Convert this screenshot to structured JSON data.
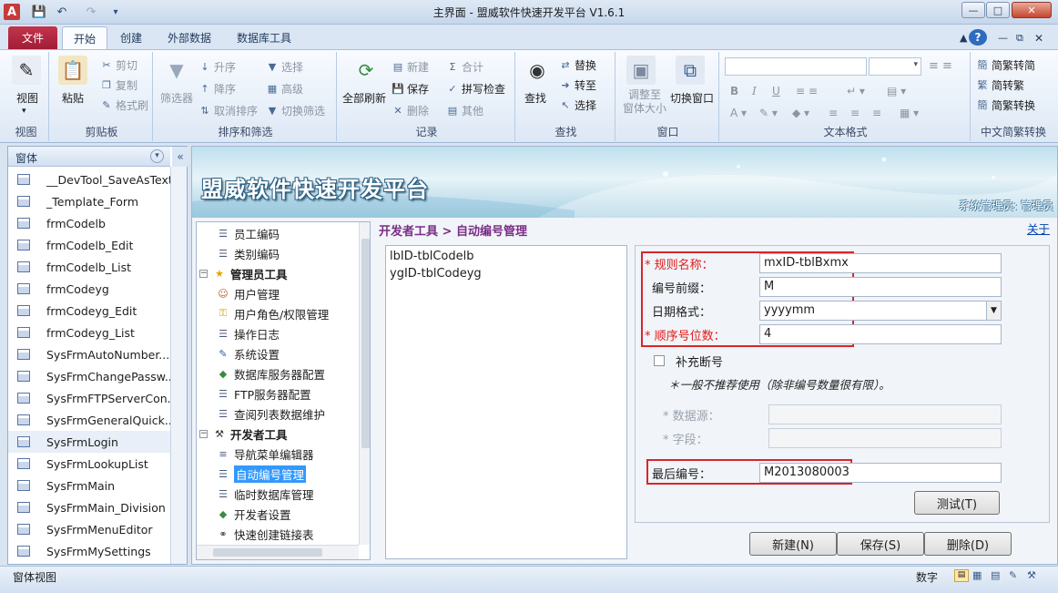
{
  "window": {
    "title": "主界面 - 盟威软件快速开发平台 V1.6.1"
  },
  "ribbon_tabs": [
    "文件",
    "开始",
    "创建",
    "外部数据",
    "数据库工具"
  ],
  "ribbon": {
    "view": {
      "label": "视图",
      "group": "视图"
    },
    "clipboard": {
      "paste": "粘贴",
      "cut": "剪切",
      "copy": "复制",
      "format": "格式刷",
      "group": "剪贴板"
    },
    "sort_filter": {
      "filter": "筛选器",
      "asc": "升序",
      "desc": "降序",
      "clear_sort": "取消排序",
      "select": "选择",
      "advanced": "高级",
      "toggle": "切换筛选",
      "group": "排序和筛选"
    },
    "records": {
      "refresh": "全部刷新",
      "new": "新建",
      "save": "保存",
      "delete": "删除",
      "total": "合计",
      "spell": "拼写检查",
      "other": "其他",
      "group": "记录"
    },
    "find": {
      "find": "查找",
      "replace": "替换",
      "goto": "转至",
      "select": "选择",
      "group": "查找"
    },
    "window": {
      "fit": "调整至\n窗体大小",
      "switch": "切换窗口",
      "group": "窗口"
    },
    "text_format": {
      "group": "文本格式"
    },
    "chinese": {
      "to_trad": "简繁转简",
      "to_simp": "简转繁",
      "convert": "简繁转换",
      "group": "中文简繁转换"
    }
  },
  "nav": {
    "title": "窗体",
    "items": [
      "__DevTool_SaveAsText",
      "_Template_Form",
      "frmCodelb",
      "frmCodelb_Edit",
      "frmCodelb_List",
      "frmCodeyg",
      "frmCodeyg_Edit",
      "frmCodeyg_List",
      "SysFrmAutoNumber...",
      "SysFrmChangePassw...",
      "SysFrmFTPServerCon...",
      "SysFrmGeneralQuick...",
      "SysFrmLogin",
      "SysFrmLookupList",
      "SysFrmMain",
      "SysFrmMain_Division",
      "SysFrmMenuEditor",
      "SysFrmMySettings"
    ]
  },
  "banner": {
    "title": "盟威软件快速开发平台",
    "user": "系统管理员: 管理员"
  },
  "tree": {
    "items": [
      {
        "label": "员工编码",
        "icon": "doc-icon"
      },
      {
        "label": "类别编码",
        "icon": "doc-icon"
      },
      {
        "label": "管理员工具",
        "icon": "star-icon"
      },
      {
        "label": "用户管理",
        "icon": "users-icon"
      },
      {
        "label": "用户角色/权限管理",
        "icon": "lock-icon"
      },
      {
        "label": "操作日志",
        "icon": "doc-icon"
      },
      {
        "label": "系统设置",
        "icon": "settings-icon"
      },
      {
        "label": "数据库服务器配置",
        "icon": "db-icon"
      },
      {
        "label": "FTP服务器配置",
        "icon": "doc-icon"
      },
      {
        "label": "查阅列表数据维护",
        "icon": "doc-icon"
      },
      {
        "label": "开发者工具",
        "icon": "tools-icon"
      },
      {
        "label": "导航菜单编辑器",
        "icon": "list-icon"
      },
      {
        "label": "自动编号管理",
        "icon": "doc-icon"
      },
      {
        "label": "临时数据库管理",
        "icon": "doc-icon"
      },
      {
        "label": "开发者设置",
        "icon": "db-icon"
      },
      {
        "label": "快速创建链接表",
        "icon": "link-icon"
      }
    ]
  },
  "content": {
    "breadcrumb": "开发者工具 > 自动编号管理",
    "about": "关于",
    "rules": [
      "lbID-tblCodelb",
      "ygID-tblCodeyg"
    ],
    "form": {
      "rule_name_label": "规则名称：",
      "rule_name": "mxID-tblBxmx",
      "prefix_label": "编号前缀：",
      "prefix": "M",
      "date_format_label": "日期格式：",
      "date_format": "yyyymm",
      "seq_digits_label": "顺序号位数：",
      "seq_digits": "4",
      "fill_gap_label": "补充断号",
      "hint": "＊一般不推荐使用（除非编号数量很有限）。",
      "datasource_label": "数据源：",
      "field_label": "字段：",
      "last_no_label": "最后编号：",
      "last_no": "M2013080003",
      "test_btn": "测试(T)"
    },
    "buttons": {
      "new": "新建(N)",
      "save": "保存(S)",
      "delete": "删除(D)"
    }
  },
  "status": {
    "left": "窗体视图",
    "right": "数字"
  }
}
